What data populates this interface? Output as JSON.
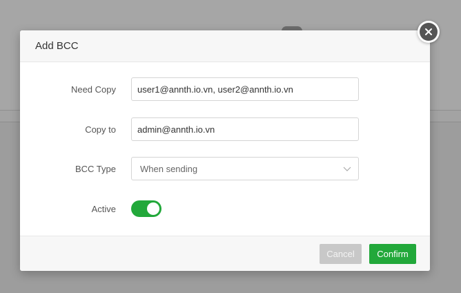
{
  "modal": {
    "title": "Add BCC",
    "fields": {
      "need_copy": {
        "label": "Need Copy",
        "value": "user1@annth.io.vn, user2@annth.io.vn"
      },
      "copy_to": {
        "label": "Copy to",
        "value": "admin@annth.io.vn"
      },
      "bcc_type": {
        "label": "BCC Type",
        "value": "When sending"
      },
      "active": {
        "label": "Active",
        "checked": true
      }
    },
    "buttons": {
      "cancel": "Cancel",
      "confirm": "Confirm"
    }
  },
  "icons": {
    "close": "close-icon",
    "select_arrow": "chevron-down-icon"
  },
  "colors": {
    "accent": "#22a83a",
    "cancel_disabled": "#c8c8c8"
  }
}
